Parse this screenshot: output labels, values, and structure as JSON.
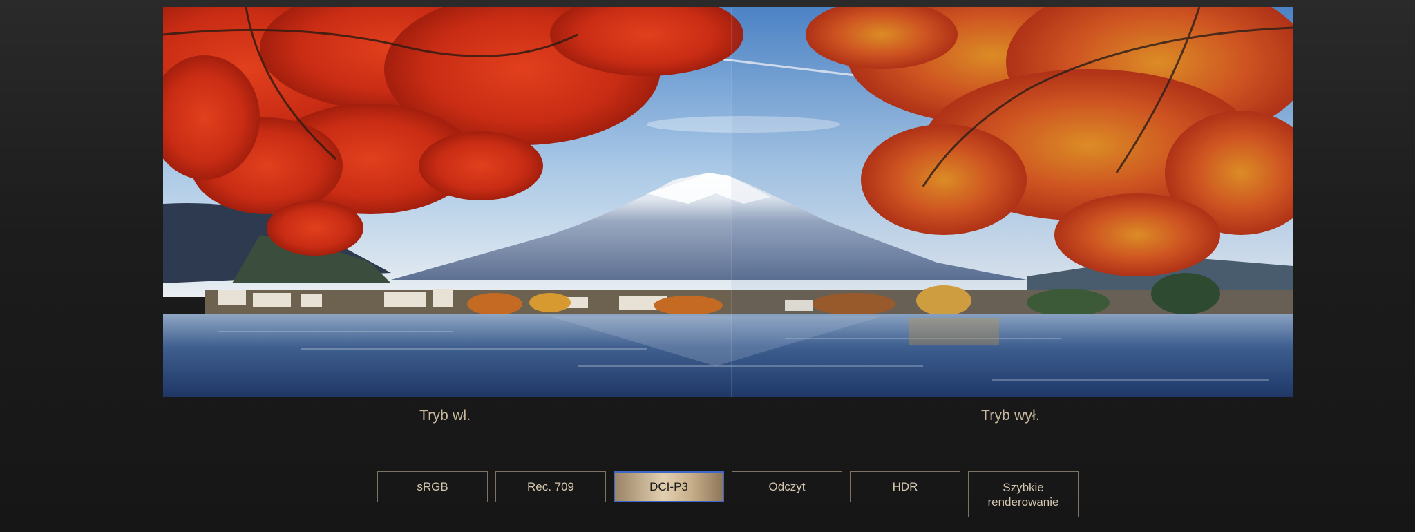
{
  "comparison": {
    "left_caption": "Tryb wł.",
    "right_caption": "Tryb wył."
  },
  "modes": {
    "selected": "DCI-P3",
    "items": [
      {
        "label": "sRGB"
      },
      {
        "label": "Rec. 709"
      },
      {
        "label": "DCI-P3"
      },
      {
        "label": "Odczyt"
      },
      {
        "label": "HDR"
      },
      {
        "label": "Szybkie renderowanie"
      }
    ]
  },
  "colors": {
    "background": "#1e1e1e",
    "caption": "#c9b9a0",
    "button_border": "#7d7264",
    "button_text": "#d5c7b1",
    "active_border": "#3e68c8",
    "active_gold": "#e2cfb0"
  }
}
